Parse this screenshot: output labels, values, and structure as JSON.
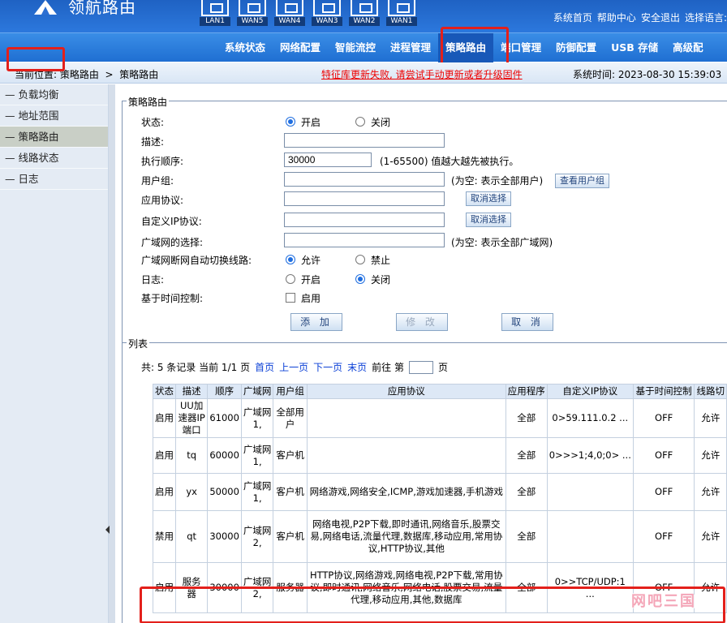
{
  "brand": {
    "name": "领航路由"
  },
  "ports": [
    "LAN1",
    "WAN5",
    "WAN4",
    "WAN3",
    "WAN2",
    "WAN1"
  ],
  "top_links": {
    "home": "系统首页",
    "help": "帮助中心",
    "logout": "安全退出",
    "language": "选择语言:"
  },
  "nav": [
    "系统状态",
    "网络配置",
    "智能流控",
    "进程管理",
    "策略路由",
    "端口管理",
    "防御配置",
    "USB 存储",
    "高级配"
  ],
  "nav_active": "策略路由",
  "breadcrumb": {
    "prefix": "当前位置: 策略路由",
    "sep": ">",
    "current": "策略路由"
  },
  "warning": "特征库更新失败, 请尝试手动更新或者升级固件",
  "systime": "系统时间: 2023-08-30 15:39:03",
  "sidebar": [
    "负载均衡",
    "地址范围",
    "策略路由",
    "线路状态",
    "日志"
  ],
  "sidebar_active": 2,
  "form": {
    "legend": "策略路由",
    "status_label": "状态:",
    "status_on": "开启",
    "status_off": "关闭",
    "desc_label": "描述:",
    "desc_value": "",
    "order_label": "执行顺序:",
    "order_value": "30000",
    "order_hint": "(1-65500) 值越大越先被执行。",
    "usergroup_label": "用户组:",
    "usergroup_value": "",
    "usergroup_hint": "(为空: 表示全部用户)",
    "view_group_btn": "查看用户组",
    "app_label": "应用协议:",
    "app_value": "",
    "cancel_select": "取消选择",
    "ipproto_label": "自定义IP协议:",
    "ipproto_value": "",
    "wan_label": "广域网的选择:",
    "wan_value": "",
    "wan_hint": "(为空: 表示全部广域网)",
    "failover_label": "广域网断网自动切换线路:",
    "failover_allow": "允许",
    "failover_deny": "禁止",
    "log_label": "日志:",
    "log_on": "开启",
    "log_off": "关闭",
    "time_label": "基于时间控制:",
    "time_enable": "启用",
    "add_btn": "添 加",
    "modify_btn": "修 改",
    "cancel_btn": "取 消"
  },
  "list": {
    "legend": "列表",
    "summary": "共: 5 条记录 当前 1/1 页",
    "first": "首页",
    "prev": "上一页",
    "next": "下一页",
    "last": "末页",
    "goto": "前往 第",
    "page_unit": "页",
    "columns": [
      "状态",
      "描述",
      "顺序",
      "广域网",
      "用户组",
      "应用协议",
      "应用程序",
      "自定义IP协议",
      "基于时间控制",
      "线路切"
    ],
    "rows": [
      [
        "启用",
        "UU加速器IP端口",
        "61000",
        "广域网1,",
        "全部用户",
        "",
        "全部",
        "0>59.111.0.2 ...",
        "OFF",
        "允许"
      ],
      [
        "启用",
        "tq",
        "60000",
        "广域网1,",
        "客户机",
        "",
        "全部",
        "0>>>1;4,0;0> ...",
        "OFF",
        "允许"
      ],
      [
        "启用",
        "yx",
        "50000",
        "广域网1,",
        "客户机",
        "网络游戏,网络安全,ICMP,游戏加速器,手机游戏",
        "全部",
        "",
        "OFF",
        "允许"
      ],
      [
        "禁用",
        "qt",
        "30000",
        "广域网2,",
        "客户机",
        "网络电视,P2P下载,即时通讯,网络音乐,股票交易,网络电话,流量代理,数据库,移动应用,常用协议,HTTP协议,其他",
        "全部",
        "",
        "OFF",
        "允许"
      ],
      [
        "启用",
        "服务器",
        "30000",
        "广域网2,",
        "服务器",
        "HTTP协议,网络游戏,网络电视,P2P下载,常用协议,即时通讯,网络音乐,网络电话,股票交易,流量代理,移动应用,其他,数据库",
        "全部",
        "0>>TCP/UDP:1 ...",
        "OFF",
        "允许"
      ]
    ]
  },
  "watermark": "网吧三国",
  "colors": {
    "header": "#2c78dd",
    "highlight": "#e3201b",
    "link": "#0a3fd6",
    "warning": "#e00000"
  }
}
